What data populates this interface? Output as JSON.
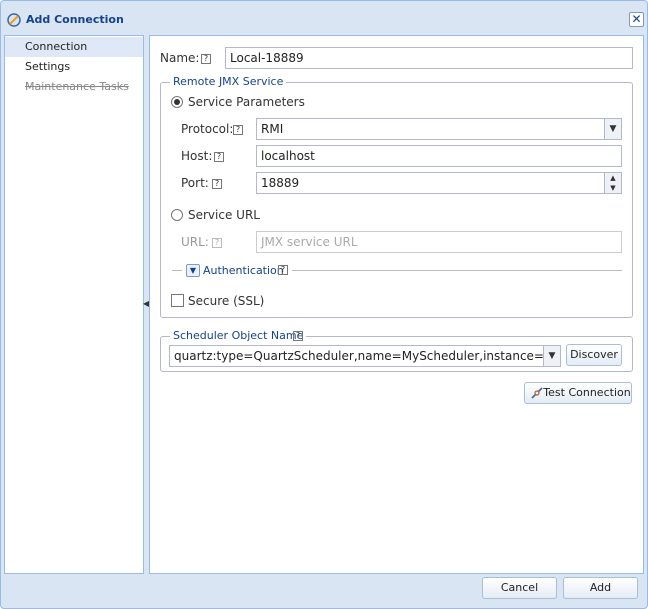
{
  "dialog": {
    "title": "Add Connection",
    "close_symbol": "✕"
  },
  "nav": {
    "items": [
      {
        "label": "Connection",
        "state": "selected"
      },
      {
        "label": "Settings",
        "state": "normal"
      },
      {
        "label": "Maintenance Tasks",
        "state": "disabled"
      }
    ]
  },
  "form": {
    "name_label": "Name:",
    "name_value": "Local-18889",
    "remote_jmx": {
      "legend": "Remote JMX Service",
      "service_parameters_label": "Service Parameters",
      "service_parameters_checked": true,
      "protocol_label": "Protocol:",
      "protocol_value": "RMI",
      "host_label": "Host:",
      "host_value": "localhost",
      "port_label": "Port:",
      "port_value": "18889",
      "service_url_label": "Service URL",
      "service_url_checked": false,
      "url_label": "URL:",
      "url_placeholder": "JMX service URL",
      "authentication_label": "Authentication",
      "secure_label": "Secure (SSL)",
      "secure_checked": false
    },
    "scheduler": {
      "legend": "Scheduler Object Name",
      "value": "quartz:type=QuartzScheduler,name=MyScheduler,instance=NON_CL",
      "discover_label": "Discover"
    },
    "test_connection_label": "Test Connection"
  },
  "footer": {
    "cancel_label": "Cancel",
    "add_label": "Add"
  },
  "help_glyph": "?",
  "colors": {
    "accent": "#15428b",
    "border": "#99bbe8",
    "background": "#d9e5f3"
  }
}
